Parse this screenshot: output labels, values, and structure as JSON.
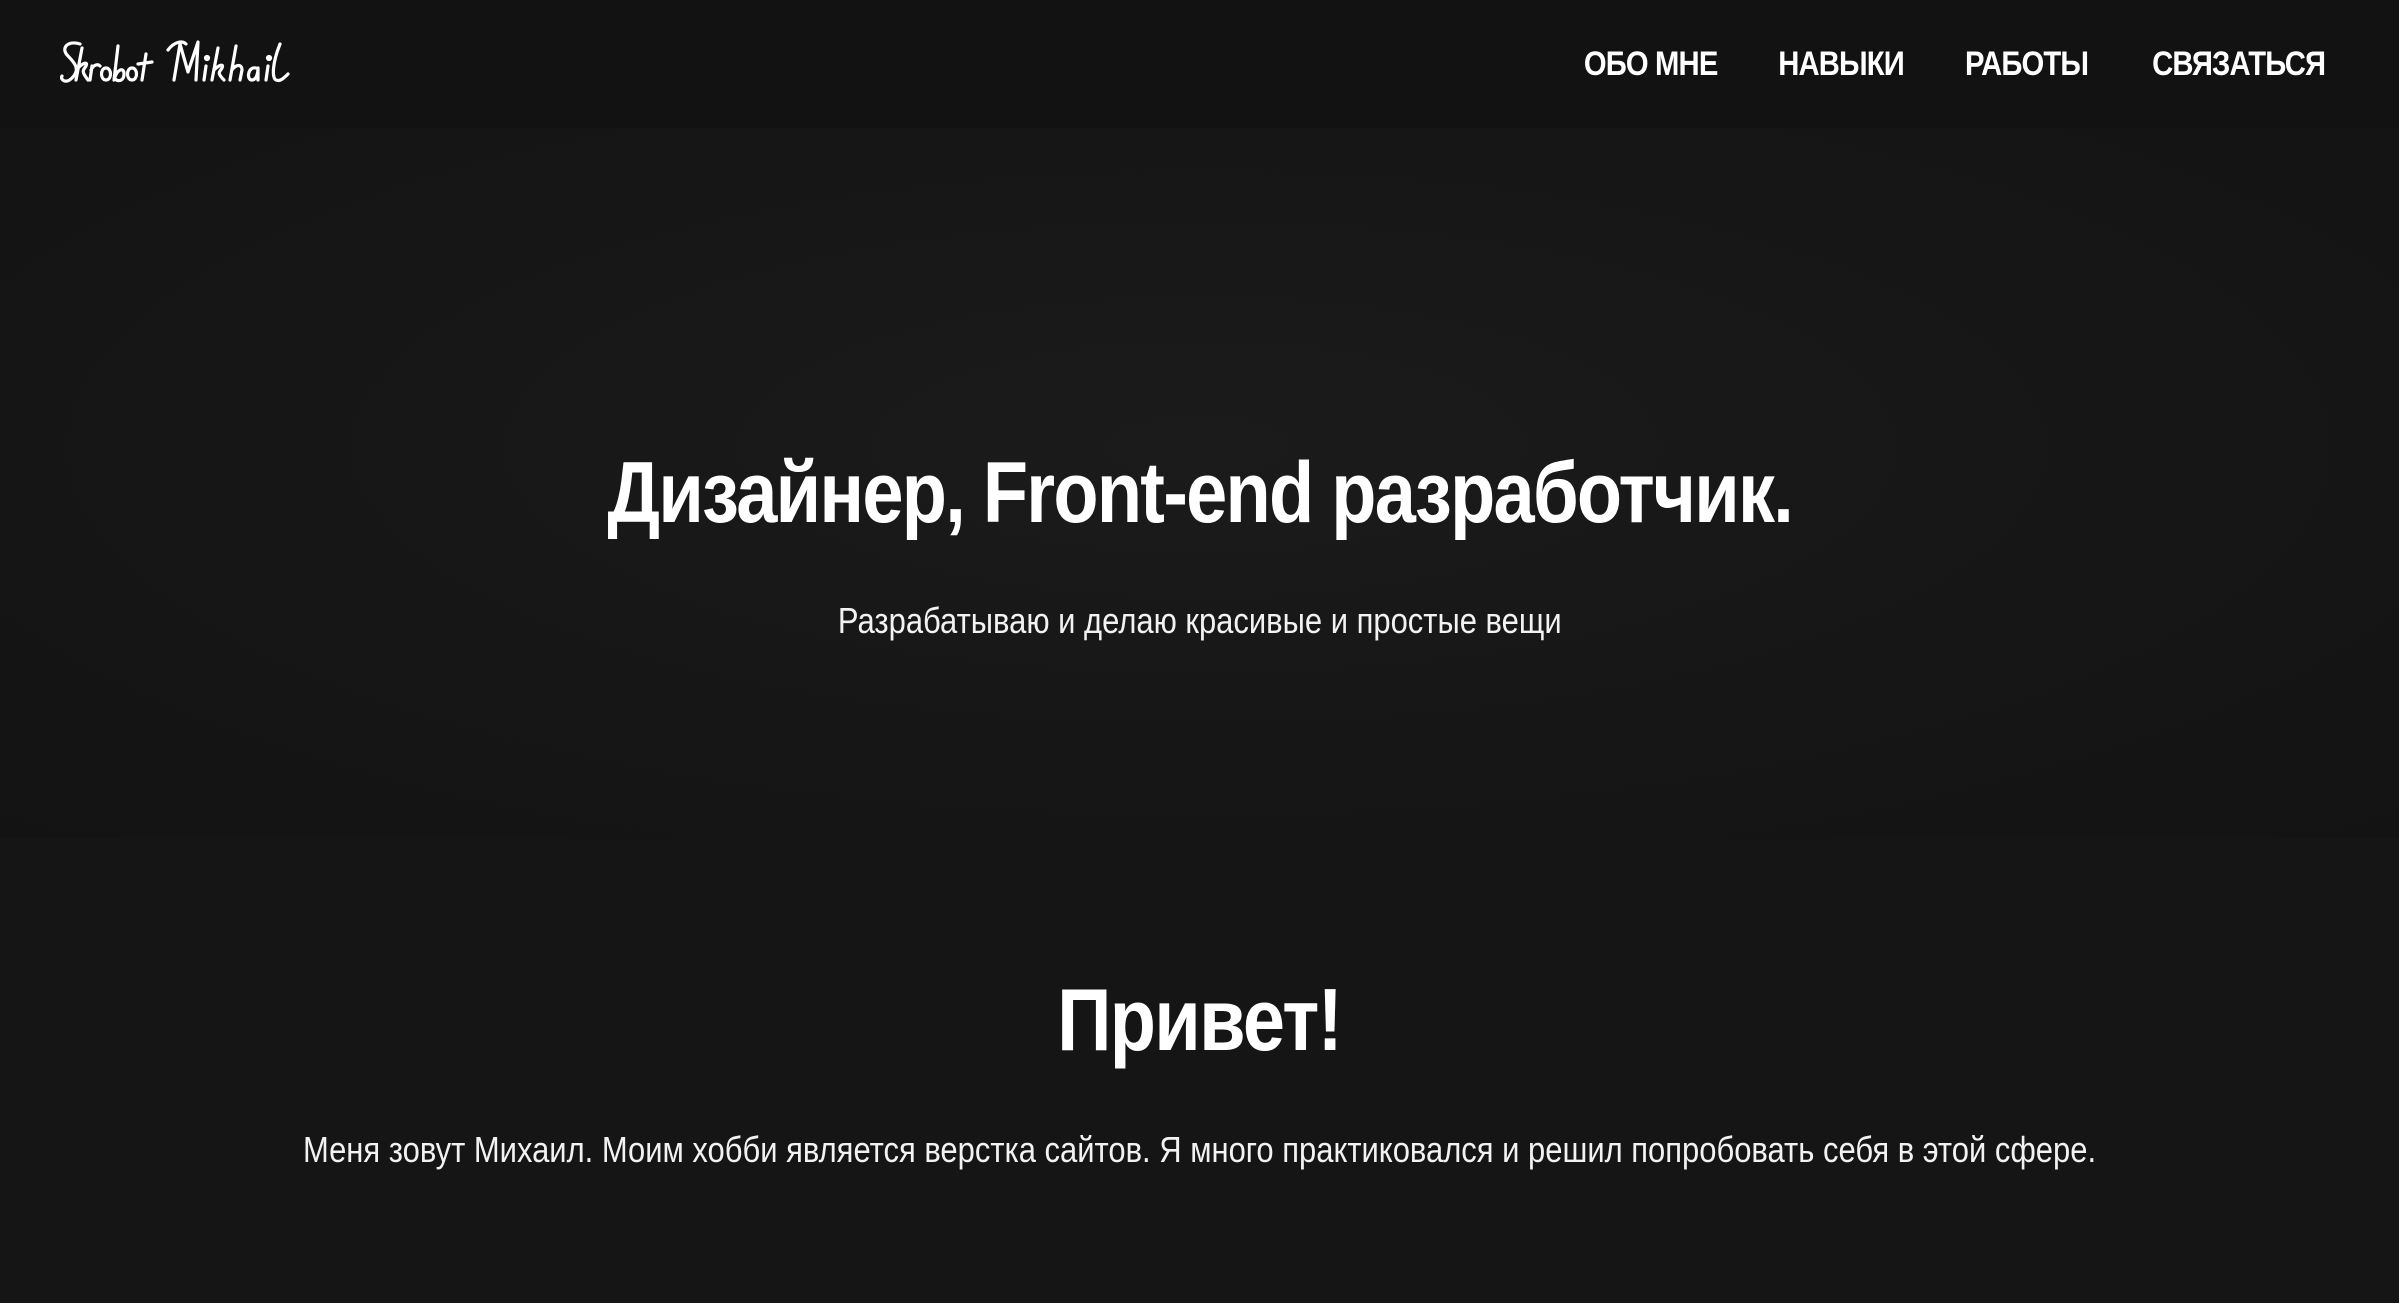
{
  "header": {
    "logo_text": "Skrobot Mikhail",
    "nav": [
      {
        "label": "ОБО МНЕ"
      },
      {
        "label": "НАВЫКИ"
      },
      {
        "label": "РАБОТЫ"
      },
      {
        "label": "СВЯЗАТЬСЯ"
      }
    ]
  },
  "hero": {
    "title": "Дизайнер, Front-end разработчик.",
    "subtitle": "Разрабатываю и делаю красивые и простые вещи"
  },
  "about": {
    "title": "Привет!",
    "text": "Меня зовут Михаил. Моим хобби является верстка сайтов. Я много практиковался и решил попробовать себя в этой сфере."
  },
  "colors": {
    "background": "#151515",
    "header_background": "#121212",
    "text": "#ffffff"
  }
}
